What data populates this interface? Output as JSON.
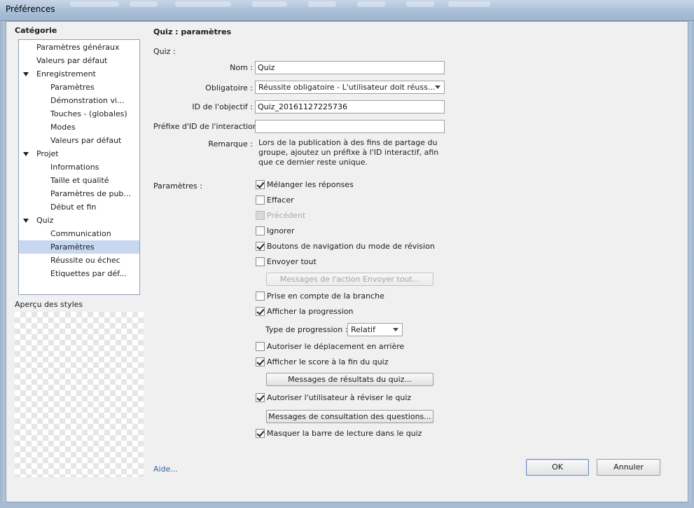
{
  "window": {
    "title": "Préférences"
  },
  "sidebar": {
    "heading": "Catégorie",
    "items": [
      {
        "label": "Paramètres généraux",
        "level": 0,
        "expandable": false,
        "selected": false
      },
      {
        "label": "Valeurs par défaut",
        "level": 0,
        "expandable": false,
        "selected": false
      },
      {
        "label": "Enregistrement",
        "level": 0,
        "expandable": true,
        "selected": false
      },
      {
        "label": "Paramètres",
        "level": 1,
        "expandable": false,
        "selected": false
      },
      {
        "label": "Démonstration vi...",
        "level": 1,
        "expandable": false,
        "selected": false
      },
      {
        "label": "Touches - (globales)",
        "level": 1,
        "expandable": false,
        "selected": false
      },
      {
        "label": "Modes",
        "level": 1,
        "expandable": false,
        "selected": false
      },
      {
        "label": "Valeurs par défaut",
        "level": 1,
        "expandable": false,
        "selected": false
      },
      {
        "label": "Projet",
        "level": 0,
        "expandable": true,
        "selected": false
      },
      {
        "label": "Informations",
        "level": 1,
        "expandable": false,
        "selected": false
      },
      {
        "label": "Taille et qualité",
        "level": 1,
        "expandable": false,
        "selected": false
      },
      {
        "label": "Paramètres de pub...",
        "level": 1,
        "expandable": false,
        "selected": false
      },
      {
        "label": "Début et fin",
        "level": 1,
        "expandable": false,
        "selected": false
      },
      {
        "label": "Quiz",
        "level": 0,
        "expandable": true,
        "selected": false
      },
      {
        "label": "Communication",
        "level": 1,
        "expandable": false,
        "selected": false
      },
      {
        "label": "Paramètres",
        "level": 1,
        "expandable": false,
        "selected": true
      },
      {
        "label": "Réussite ou échec",
        "level": 1,
        "expandable": false,
        "selected": false
      },
      {
        "label": "Etiquettes par déf...",
        "level": 1,
        "expandable": false,
        "selected": false
      }
    ],
    "preview_label": "Aperçu des styles"
  },
  "panel": {
    "title": "Quiz : paramètres",
    "quiz_group": "Quiz :",
    "name_label": "Nom :",
    "name_value": "Quiz",
    "required_label": "Obligatoire :",
    "required_value": "Réussite obligatoire - L'utilisateur doit réuss...",
    "objective_label": "ID de l'objectif :",
    "objective_value": "Quiz_20161127225736",
    "prefix_label": "Préfixe d'ID de l'interaction :",
    "prefix_value": "",
    "remark_label": "Remarque :",
    "remark_text": "Lors de la publication à des fins de partage du groupe, ajoutez un préfixe à l'ID interactif, afin que ce dernier reste unique.",
    "settings_label": "Paramètres :",
    "checkboxes": {
      "shuffle": {
        "label": "Mélanger les réponses",
        "checked": true
      },
      "clear": {
        "label": "Effacer",
        "checked": false
      },
      "back": {
        "label": "Précédent",
        "checked": false,
        "disabled": true
      },
      "skip": {
        "label": "Ignorer",
        "checked": false
      },
      "review_nav": {
        "label": "Boutons de navigation du mode de révision",
        "checked": true
      },
      "submit_all": {
        "label": "Envoyer tout",
        "checked": false
      },
      "branching": {
        "label": "Prise en compte de la branche",
        "checked": false
      },
      "show_progress": {
        "label": "Afficher la progression",
        "checked": true
      },
      "allow_backward": {
        "label": "Autoriser le déplacement en arrière",
        "checked": false
      },
      "show_score": {
        "label": "Afficher le score à la fin du quiz",
        "checked": true
      },
      "allow_review": {
        "label": "Autoriser l'utilisateur à réviser le quiz",
        "checked": true
      },
      "hide_playbar": {
        "label": "Masquer la barre de lecture dans le quiz",
        "checked": true
      }
    },
    "submit_all_messages_button": "Messages de l'action Envoyer tout...",
    "progress_type_label": "Type de progression :",
    "progress_type_value": "Relatif",
    "result_messages_button": "Messages de résultats du quiz...",
    "review_messages_button": "Messages de consultation des questions..."
  },
  "footer": {
    "help_link": "Aide...",
    "ok_button": "OK",
    "cancel_button": "Annuler"
  }
}
